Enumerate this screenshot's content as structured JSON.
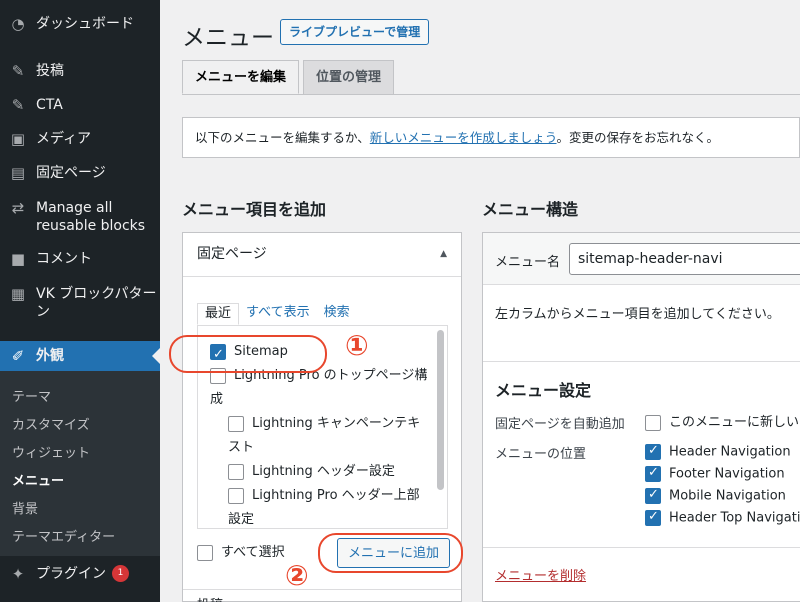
{
  "sidebar": {
    "items": [
      {
        "icon": "dashboard-icon",
        "glyph": "◔",
        "label": "ダッシュボード"
      },
      {
        "icon": "pin-icon",
        "glyph": "✎",
        "label": "投稿"
      },
      {
        "icon": "pin-icon",
        "glyph": "✎",
        "label": "CTA"
      },
      {
        "icon": "media-icon",
        "glyph": "▣",
        "label": "メディア"
      },
      {
        "icon": "page-icon",
        "glyph": "▤",
        "label": "固定ページ"
      },
      {
        "icon": "loop-icon",
        "glyph": "⇄",
        "label": "Manage all reusable blocks"
      },
      {
        "icon": "comment-icon",
        "glyph": "■",
        "label": "コメント"
      },
      {
        "icon": "blocks-icon",
        "glyph": "▦",
        "label": "VK ブロックパターン"
      },
      {
        "icon": "appearance-icon",
        "glyph": "✐",
        "label": "外観"
      },
      {
        "icon": "plugin-icon",
        "glyph": "✦",
        "label": "プラグイン"
      }
    ],
    "plugin_badge": "1",
    "submenu": [
      "テーマ",
      "カスタマイズ",
      "ウィジェット",
      "メニュー",
      "背景",
      "テーマエディター"
    ]
  },
  "header": {
    "title": "メニュー",
    "preview_button": "ライブプレビューで管理",
    "tabs": [
      "メニューを編集",
      "位置の管理"
    ]
  },
  "notice": {
    "before": "以下のメニューを編集するか、",
    "link": "新しいメニューを作成しましょう",
    "after": "。変更の保存をお忘れなく。"
  },
  "add_items": {
    "heading": "メニュー項目を追加",
    "panel_title": "固定ページ",
    "subtabs": [
      "最近",
      "すべて表示",
      "検索"
    ],
    "pages": [
      {
        "label": "Sitemap",
        "checked": true
      },
      {
        "label": "Lightning Pro のトップページ構成",
        "checked": false
      },
      {
        "label": "Lightning キャンペーンテキスト",
        "checked": false
      },
      {
        "label": "Lightning ヘッダー設定",
        "checked": false
      },
      {
        "label": "Lightning Pro ヘッダー上部設定",
        "checked": false
      }
    ],
    "select_all": "すべて選択",
    "add_button": "メニューに追加",
    "next_panel": "投稿",
    "annotations": [
      "①",
      "②"
    ]
  },
  "structure": {
    "heading": "メニュー構造",
    "name_label": "メニュー名",
    "name_value": "sitemap-header-navi",
    "hint": "左カラムからメニュー項目を追加してください。",
    "settings_title": "メニュー設定",
    "auto_add_label": "固定ページを自動追加",
    "auto_add_option": "このメニューに新しい",
    "location_label": "メニューの位置",
    "locations": [
      {
        "label": "Header Navigation",
        "checked": true
      },
      {
        "label": "Footer Navigation",
        "checked": true
      },
      {
        "label": "Mobile Navigation",
        "checked": true
      },
      {
        "label": "Header Top Navigation",
        "checked": true
      }
    ],
    "delete_link": "メニューを削除"
  },
  "colors": {
    "sidebar_bg": "#1d2327",
    "accent": "#2271b1",
    "annotation": "#e8472d",
    "delete": "#b32d2e"
  }
}
